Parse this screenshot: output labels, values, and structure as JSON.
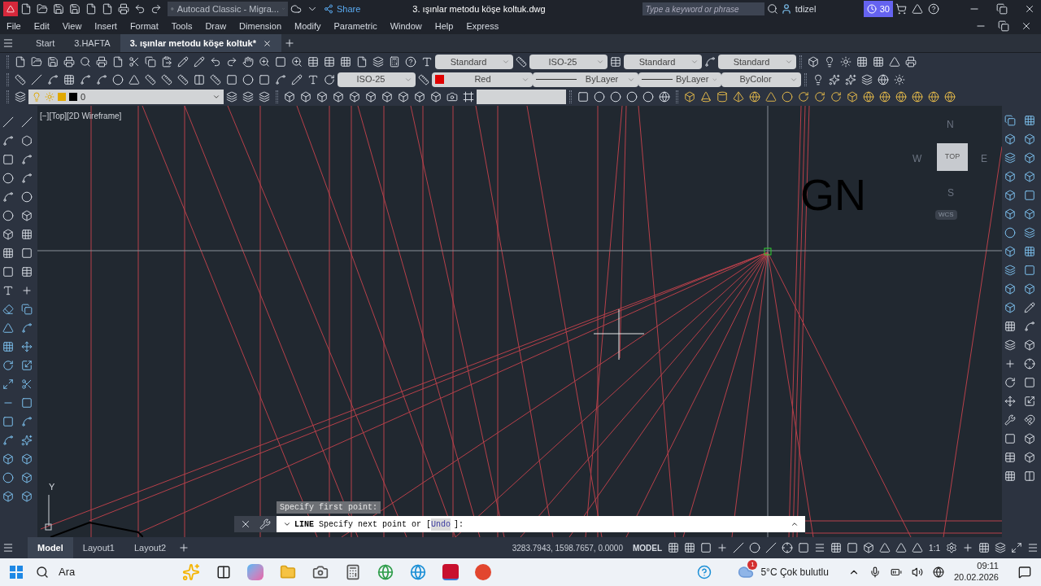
{
  "title_bar": {
    "workspace": "Autocad Classic - Migra...",
    "share": "Share",
    "title": "3. ışınlar metodu köşe koltuk.dwg",
    "search_placeholder": "Type a keyword or phrase",
    "user": "tdizel",
    "trial_days": "30"
  },
  "menu": [
    "File",
    "Edit",
    "View",
    "Insert",
    "Format",
    "Tools",
    "Draw",
    "Dimension",
    "Modify",
    "Parametric",
    "Window",
    "Help",
    "Express"
  ],
  "tabs": [
    {
      "label": "Start",
      "selected": false
    },
    {
      "label": "3.HAFTA",
      "selected": false
    },
    {
      "label": "3. ışınlar metodu köşe koltuk*",
      "selected": true
    }
  ],
  "toolbars": {
    "text_style": "Standard",
    "dim_style": "ISO-25",
    "table_style": "Standard",
    "mleader_style": "Standard",
    "dim_style_2": "ISO-25",
    "color_label": "Red",
    "linetype": "ByLayer",
    "lineweight": "ByLayer",
    "plot_style": "ByColor",
    "layer": "0"
  },
  "viewport_label": "[−][Top][2D Wireframe]",
  "canvas": {
    "text": "GN",
    "ucs_axis": "Y"
  },
  "viewcube": {
    "north": "N",
    "west": "W",
    "east": "E",
    "south": "S",
    "face": "TOP",
    "ucs": "WCS"
  },
  "command": {
    "tooltip": "Specify first point:",
    "name": "LINE",
    "prompt": "Specify next point or [",
    "option": "Undo",
    "suffix": "]:"
  },
  "layout_tabs": [
    {
      "label": "Model",
      "selected": true
    },
    {
      "label": "Layout1",
      "selected": false
    },
    {
      "label": "Layout2",
      "selected": false
    }
  ],
  "status": {
    "coordinates": "3283.7943, 1598.7657, 0.0000",
    "space": "MODEL",
    "scale": "1:1"
  },
  "taskbar": {
    "search": "Ara",
    "notification": "1",
    "weather": "5°C Çok bulutlu",
    "time": "09:11",
    "date": "20.02.2026"
  }
}
